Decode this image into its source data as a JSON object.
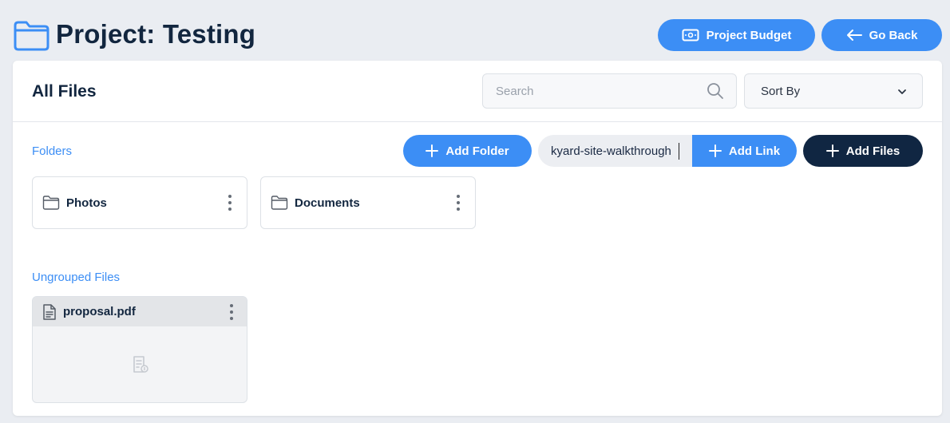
{
  "header": {
    "title": "Project: Testing",
    "budget_label": "Project Budget",
    "back_label": "Go Back"
  },
  "card": {
    "title": "All Files",
    "search": {
      "placeholder": "Search",
      "value": ""
    },
    "sort": {
      "selected": "Sort By"
    }
  },
  "folders": {
    "section_label": "Folders",
    "add_folder_label": "Add Folder",
    "link_input_value": "kyard-site-walkthrough",
    "add_link_label": "Add Link",
    "add_files_label": "Add Files",
    "items": [
      {
        "name": "Photos"
      },
      {
        "name": "Documents"
      }
    ]
  },
  "ungrouped": {
    "section_label": "Ungrouped Files",
    "files": [
      {
        "name": "proposal.pdf"
      }
    ]
  },
  "colors": {
    "accent": "#3c8ef5",
    "dark": "#102642",
    "background": "#eaedf2"
  }
}
